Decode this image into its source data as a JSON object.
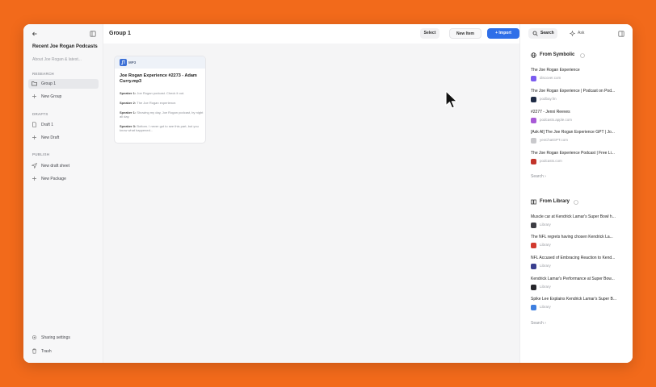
{
  "sidebar": {
    "title": "Recent Joe Rogan Podcasts",
    "subtitle": "About Joe Rogan & latest...",
    "sections": {
      "research": "RESEARCH",
      "drafts": "DRAFTS",
      "publish": "PUBLISH"
    },
    "items": {
      "group1": "Group 1",
      "new_group": "New Group",
      "draft1": "Draft 1",
      "new_draft": "New Draft",
      "new_draft_sheet": "New draft sheet",
      "new_package": "New Package",
      "sharing": "Sharing settings",
      "trash": "Trash"
    }
  },
  "main": {
    "title": "Group 1",
    "buttons": {
      "select": "Select",
      "new_item": "New Item",
      "import": "+ Import"
    },
    "card": {
      "tag": "MP3",
      "title": "Joe Rogan Experience #2273 - Adam Curry.mp3",
      "lines": [
        {
          "speaker": "Speaker 1:",
          "text": " Joe Rogan podcast. Check it out."
        },
        {
          "speaker": "Speaker 2:",
          "text": " The Joe Rogan experience."
        },
        {
          "speaker": "Speaker 1:",
          "text": " Showing my day, Joe Rogan podcast, by night all day."
        },
        {
          "speaker": "Speaker 3:",
          "text": " Bottom. I never got to see this part, but you know what happened..."
        }
      ]
    }
  },
  "right_panel": {
    "tabs": {
      "search": "Search",
      "ask": "Ask"
    },
    "symbolic": {
      "title": "From Symbolic",
      "results": [
        {
          "title": "The Joe Rogan Experience",
          "source": "discover.com",
          "color": "#7b5cf0"
        },
        {
          "title": "The Joe Rogan Experience | Podcast on Pod...",
          "source": "podbay.fm",
          "color": "#1f2b45"
        },
        {
          "title": "#2277 - Jenni Reeves",
          "source": "podcasts.apple.com",
          "color": "#a85ad6"
        },
        {
          "title": "[Ask AI] The Joe Rogan Experience GPT | Jo...",
          "source": "yesChatGPT.com",
          "color": "#c9c9cc"
        },
        {
          "title": "The Joe Rogan Experience Podcast | Free Li...",
          "source": "podcasts.com",
          "color": "#c2342a"
        }
      ],
      "more": "Search"
    },
    "library": {
      "title": "From Library",
      "results": [
        {
          "title": "Muscle car at Kendrick Lamar's Super Bowl h...",
          "source": "Library",
          "color": "#3d3d44"
        },
        {
          "title": "The NFL regrets having chosen Kendrick La...",
          "source": "Library",
          "color": "#d23a2e"
        },
        {
          "title": "NFL Accused of Embracing Reaction to Kend...",
          "source": "Library",
          "color": "#3a3f8f"
        },
        {
          "title": "Kendrick Lamar's Performance at Super Bow...",
          "source": "Library",
          "color": "#26262b"
        },
        {
          "title": "Spike Lee Explains Kendrick Lamar's Super B...",
          "source": "Library",
          "color": "#3e7fe0"
        }
      ],
      "more": "Search"
    }
  }
}
